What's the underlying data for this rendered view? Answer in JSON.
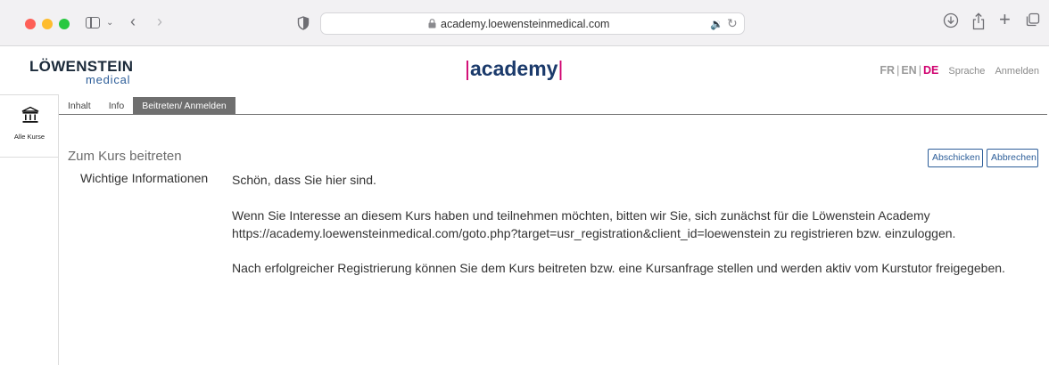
{
  "browser": {
    "url": "academy.loewensteinmedical.com"
  },
  "header": {
    "logo_main": "LÖWENSTEIN",
    "logo_sub": "medical",
    "brand_bar_left": "|",
    "brand_text": "academy",
    "brand_bar_right": "|",
    "languages": [
      {
        "label": "FR",
        "active": false
      },
      {
        "label": "EN",
        "active": false
      },
      {
        "label": "DE",
        "active": true
      }
    ],
    "language_separator": "|",
    "language_label": "Sprache",
    "login_label": "Anmelden"
  },
  "left_rail": {
    "items": [
      {
        "label": "Alle Kurse",
        "icon": "institution-icon"
      }
    ]
  },
  "tabs": [
    {
      "label": "Inhalt",
      "active": false
    },
    {
      "label": "Info",
      "active": false
    },
    {
      "label": "Beitreten/ Anmelden",
      "active": true
    }
  ],
  "page": {
    "title": "Zum Kurs beitreten",
    "submit_label": "Abschicken",
    "cancel_label": "Abbrechen"
  },
  "content": {
    "label": "Wichtige Informationen",
    "paragraph1": "Schön, dass Sie hier sind.",
    "paragraph2_line1": "Wenn Sie Interesse an diesem Kurs haben und teilnehmen möchten, bitten wir Sie, sich zunächst für die Löwenstein Academy",
    "paragraph2_line2": "https://academy.loewensteinmedical.com/goto.php?target=usr_registration&client_id=loewenstein zu registrieren bzw. einzuloggen.",
    "paragraph3": "Nach erfolgreicher Registrierung können Sie dem Kurs beitreten bzw. eine Kursanfrage stellen und werden aktiv vom Kurstutor freigegeben."
  },
  "colors": {
    "brand_magenta": "#d0006f",
    "brand_blue": "#1b3a6b",
    "tab_active_bg": "#6f6f6f"
  }
}
